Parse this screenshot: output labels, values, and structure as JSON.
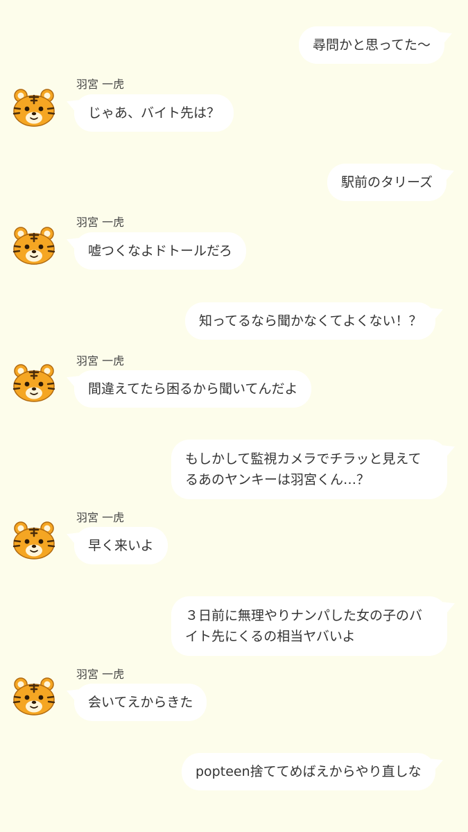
{
  "messages": [
    {
      "side": "right",
      "text": "尋問かと思ってた〜"
    },
    {
      "side": "left",
      "sender": "羽宮 一虎",
      "text": "じゃあ、バイト先は？"
    },
    {
      "side": "right",
      "text": "駅前のタリーズ"
    },
    {
      "side": "left",
      "sender": "羽宮 一虎",
      "text": "嘘つくなよドトールだろ"
    },
    {
      "side": "right",
      "text": "知ってるなら聞かなくてよくない！？"
    },
    {
      "side": "left",
      "sender": "羽宮 一虎",
      "text": "間違えてたら困るから聞いてんだよ"
    },
    {
      "side": "right",
      "lines": [
        "もしかして監視カメラでチラッと見えて",
        "るあのヤンキーは羽宮くん…？"
      ]
    },
    {
      "side": "left",
      "sender": "羽宮 一虎",
      "text": "早く来いよ"
    },
    {
      "side": "right",
      "lines": [
        "３日前に無理やりナンパした女の子のバ",
        "イト先にくるの相当ヤバいよ"
      ]
    },
    {
      "side": "left",
      "sender": "羽宮 一虎",
      "text": "会いてえからきた"
    },
    {
      "side": "right",
      "text": "popteen捨ててめばえからやり直しな"
    }
  ],
  "avatar_icon": "tiger-face-icon",
  "colors": {
    "background": "#fdfdeb",
    "bubble": "#ffffff",
    "tiger_orange": "#f5a623"
  }
}
